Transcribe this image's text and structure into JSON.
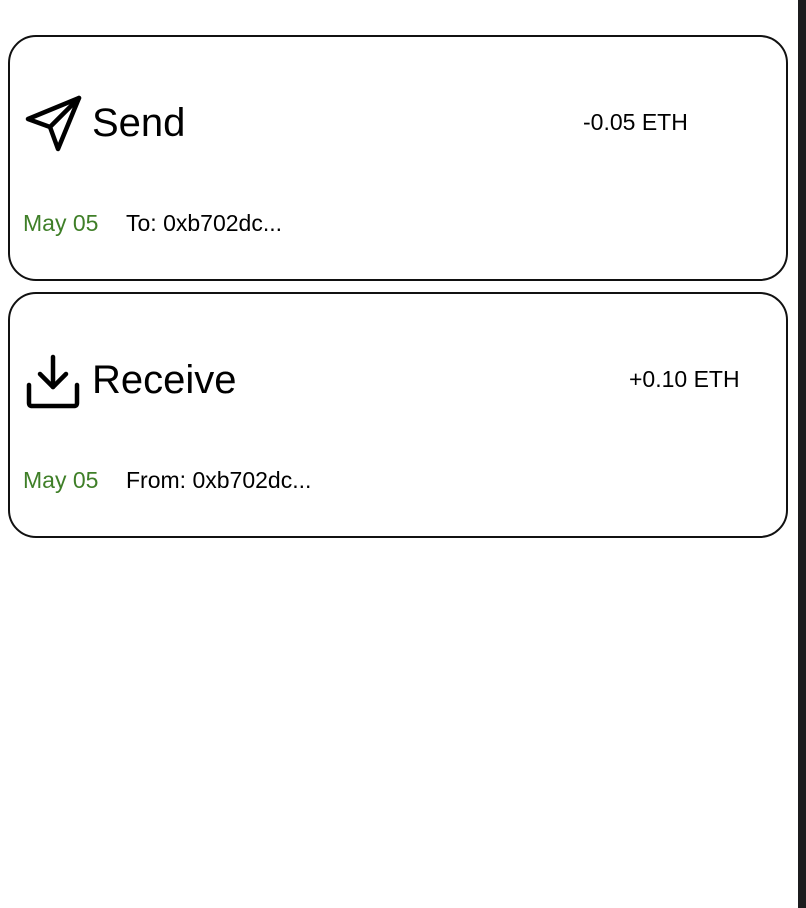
{
  "theme": {
    "date_color": "#3f7f28",
    "border_color": "#111111"
  },
  "transactions": [
    {
      "type": "Send",
      "icon": "send-icon",
      "amount": "-0.05 ETH",
      "date": "May 05",
      "address": "To: 0xb702dc..."
    },
    {
      "type": "Receive",
      "icon": "download-icon",
      "amount": "+0.10 ETH",
      "date": "May 05",
      "address": "From: 0xb702dc..."
    }
  ]
}
